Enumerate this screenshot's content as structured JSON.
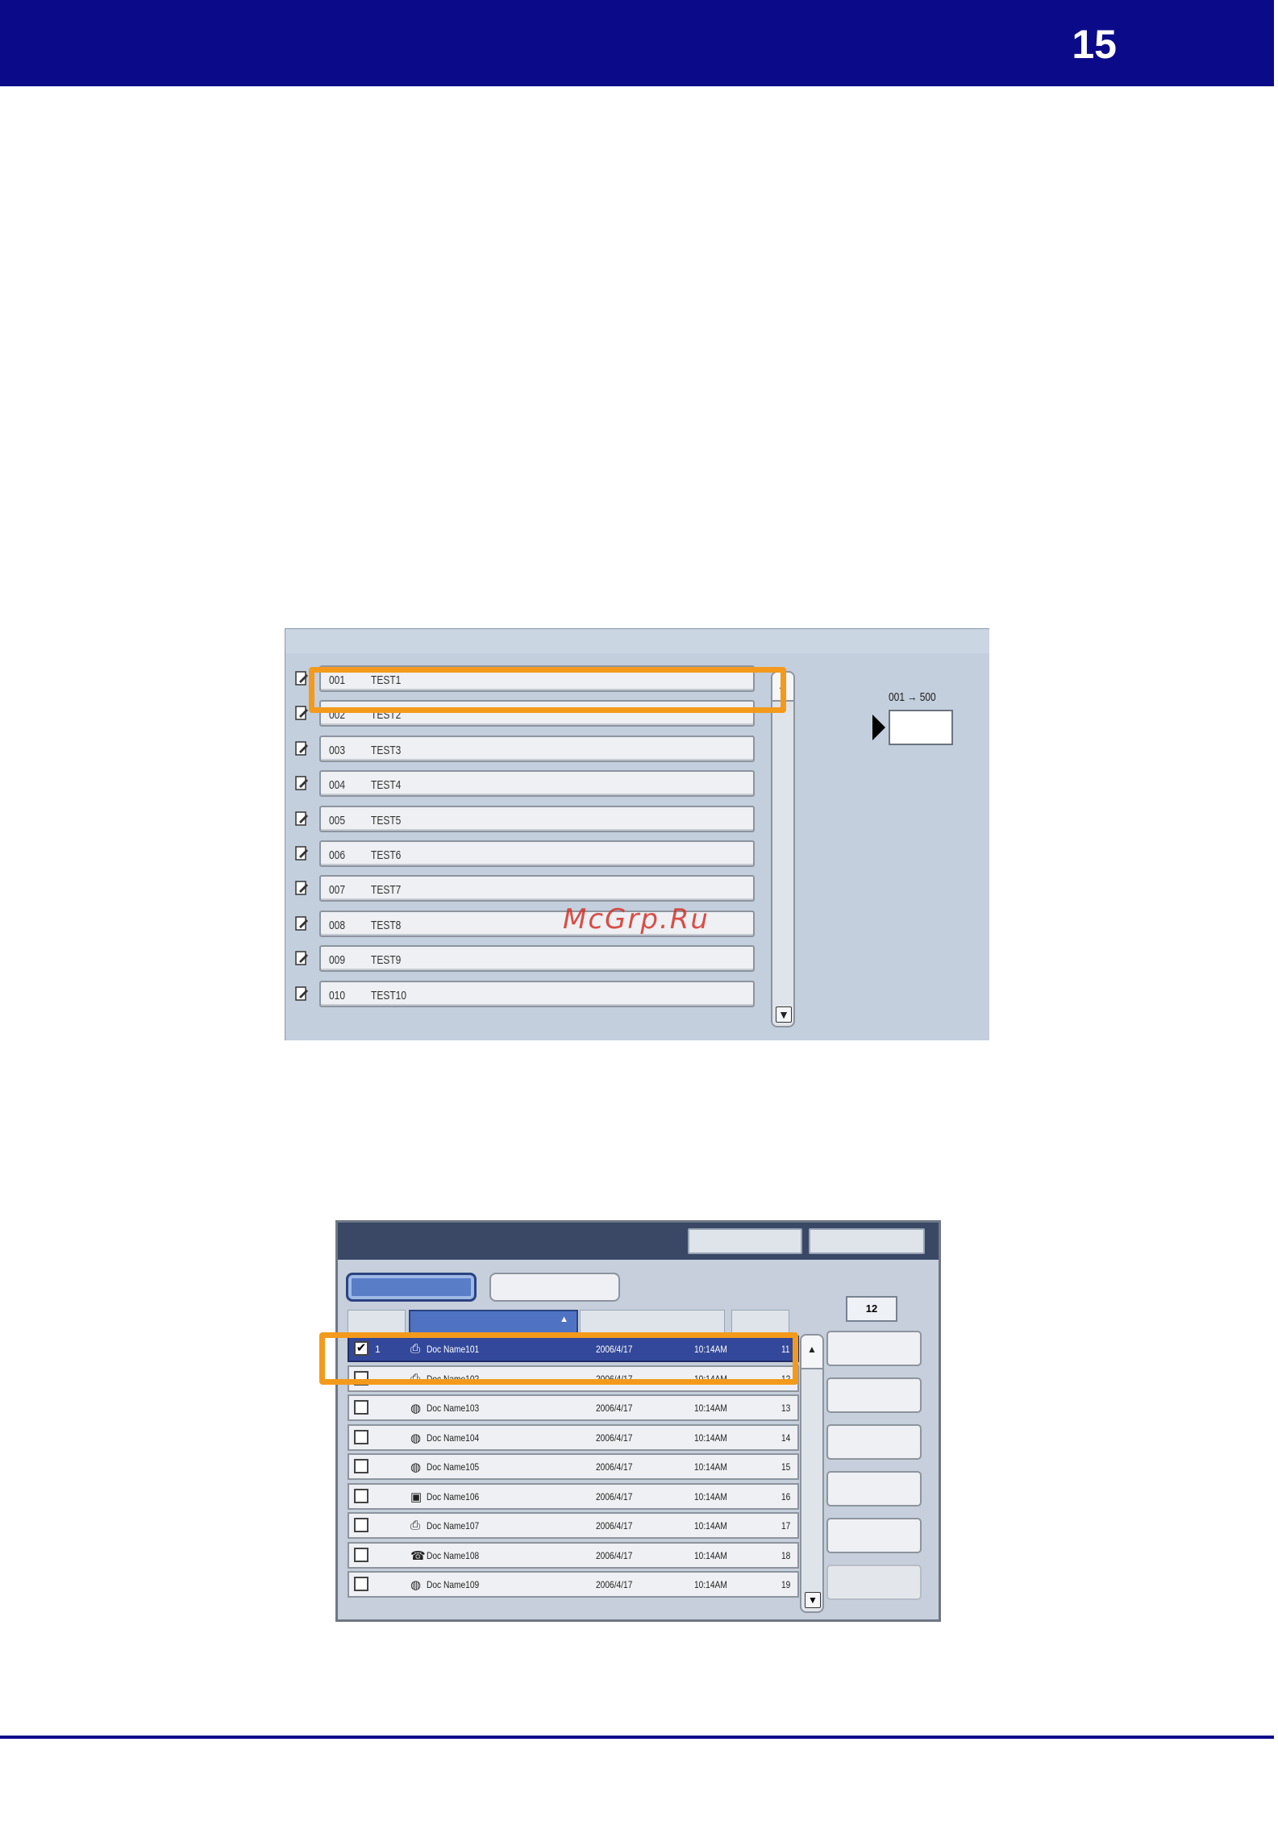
{
  "header": {
    "page_number": "15",
    "bar_color": "#0b0b8a"
  },
  "watermark": "McGrp.Ru",
  "mailbox_screen": {
    "range_label": "001 → 500",
    "range_value": "",
    "rows": [
      {
        "number": "001",
        "name": "TEST1"
      },
      {
        "number": "002",
        "name": "TEST2"
      },
      {
        "number": "003",
        "name": "TEST3"
      },
      {
        "number": "004",
        "name": "TEST4"
      },
      {
        "number": "005",
        "name": "TEST5"
      },
      {
        "number": "006",
        "name": "TEST6"
      },
      {
        "number": "007",
        "name": "TEST7"
      },
      {
        "number": "008",
        "name": "TEST8"
      },
      {
        "number": "009",
        "name": "TEST9"
      },
      {
        "number": "010",
        "name": "TEST10"
      }
    ],
    "highlight_color": "#f39a1c"
  },
  "document_screen": {
    "count": "12",
    "rows": [
      {
        "checked": true,
        "index": "1",
        "icon": "scanner-icon",
        "name": "Doc Name101",
        "date": "2006/4/17",
        "time": "10:14AM",
        "pages": "11"
      },
      {
        "checked": false,
        "index": "",
        "icon": "scanner-icon",
        "name": "Doc Name102",
        "date": "2006/4/17",
        "time": "10:14AM",
        "pages": "12"
      },
      {
        "checked": false,
        "index": "",
        "icon": "globe-icon",
        "name": "Doc Name103",
        "date": "2006/4/17",
        "time": "10:14AM",
        "pages": "13"
      },
      {
        "checked": false,
        "index": "",
        "icon": "globe-icon",
        "name": "Doc Name104",
        "date": "2006/4/17",
        "time": "10:14AM",
        "pages": "14"
      },
      {
        "checked": false,
        "index": "",
        "icon": "globe-icon",
        "name": "Doc Name105",
        "date": "2006/4/17",
        "time": "10:14AM",
        "pages": "15"
      },
      {
        "checked": false,
        "index": "",
        "icon": "box-icon",
        "name": "Doc Name106",
        "date": "2006/4/17",
        "time": "10:14AM",
        "pages": "16"
      },
      {
        "checked": false,
        "index": "",
        "icon": "scanner-icon",
        "name": "Doc Name107",
        "date": "2006/4/17",
        "time": "10:14AM",
        "pages": "17"
      },
      {
        "checked": false,
        "index": "",
        "icon": "fax-icon",
        "name": "Doc Name108",
        "date": "2006/4/17",
        "time": "10:14AM",
        "pages": "18"
      },
      {
        "checked": false,
        "index": "",
        "icon": "globe-icon",
        "name": "Doc Name109",
        "date": "2006/4/17",
        "time": "10:14AM",
        "pages": "19"
      }
    ],
    "selected_row_color": "#33489a",
    "highlight_color": "#f39a1c"
  }
}
